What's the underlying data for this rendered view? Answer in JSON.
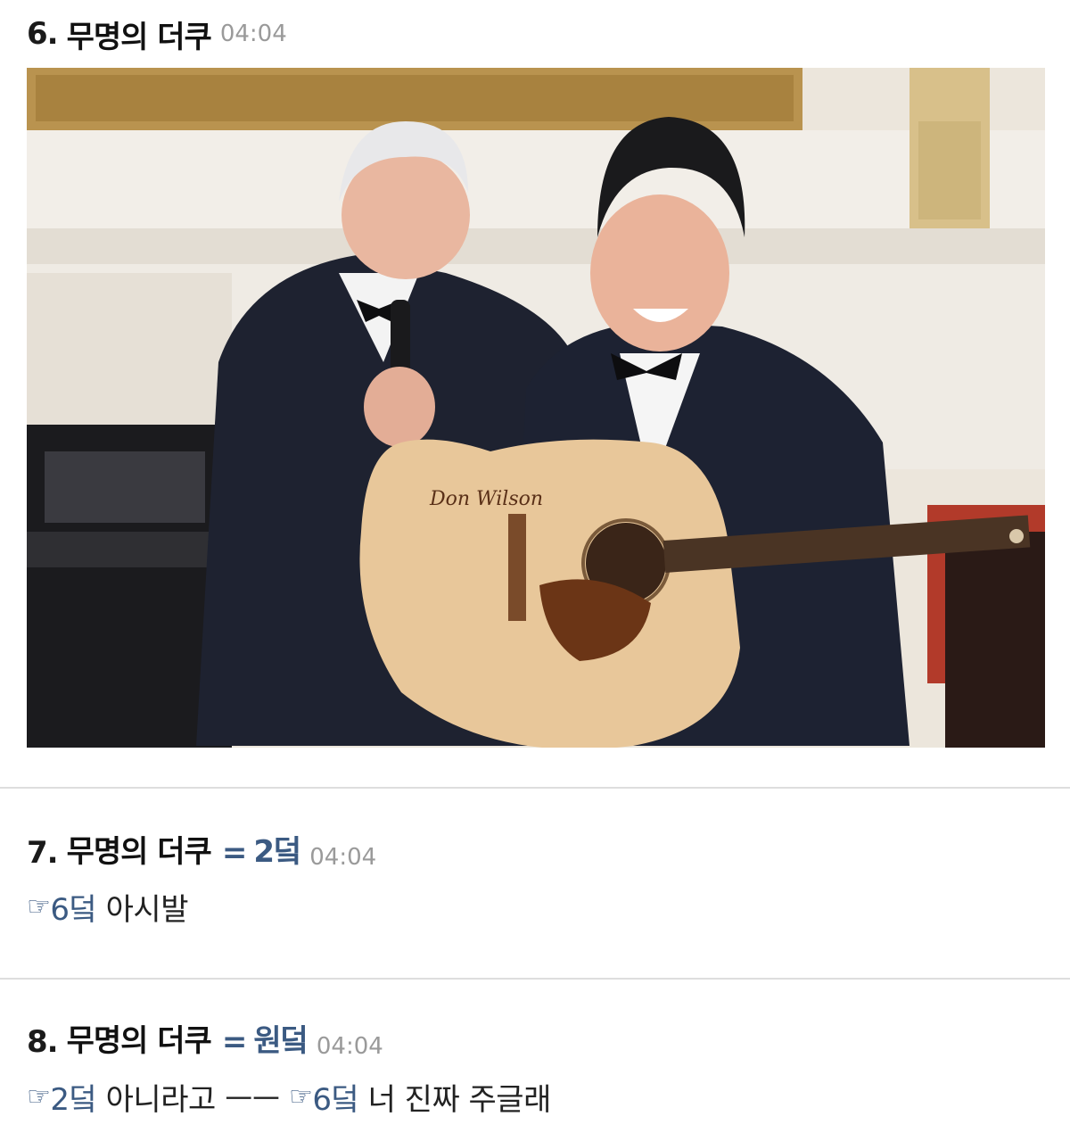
{
  "comments": [
    {
      "number": "6.",
      "nickname": "무명의 더쿠",
      "time": "04:04",
      "image": {
        "description_icon": "photo-icon",
        "signature_text": "Don Wilson"
      }
    },
    {
      "number": "7.",
      "nickname": "무명의 더쿠",
      "equals": "=",
      "dest": "2덬",
      "time": "04:04",
      "body": [
        {
          "type": "ref",
          "pointer": "☞",
          "text": "6덬"
        },
        {
          "type": "text",
          "text": " 아시발"
        }
      ]
    },
    {
      "number": "8.",
      "nickname": "무명의 더쿠",
      "equals": "=",
      "dest": "원덬",
      "time": "04:04",
      "body": [
        {
          "type": "ref",
          "pointer": "☞",
          "text": "2덬"
        },
        {
          "type": "text",
          "text": " 아니라고 ㅡㅡ "
        },
        {
          "type": "ref",
          "pointer": "☞",
          "text": "6덬"
        },
        {
          "type": "text",
          "text": " 너 진짜 주글래"
        }
      ]
    }
  ]
}
